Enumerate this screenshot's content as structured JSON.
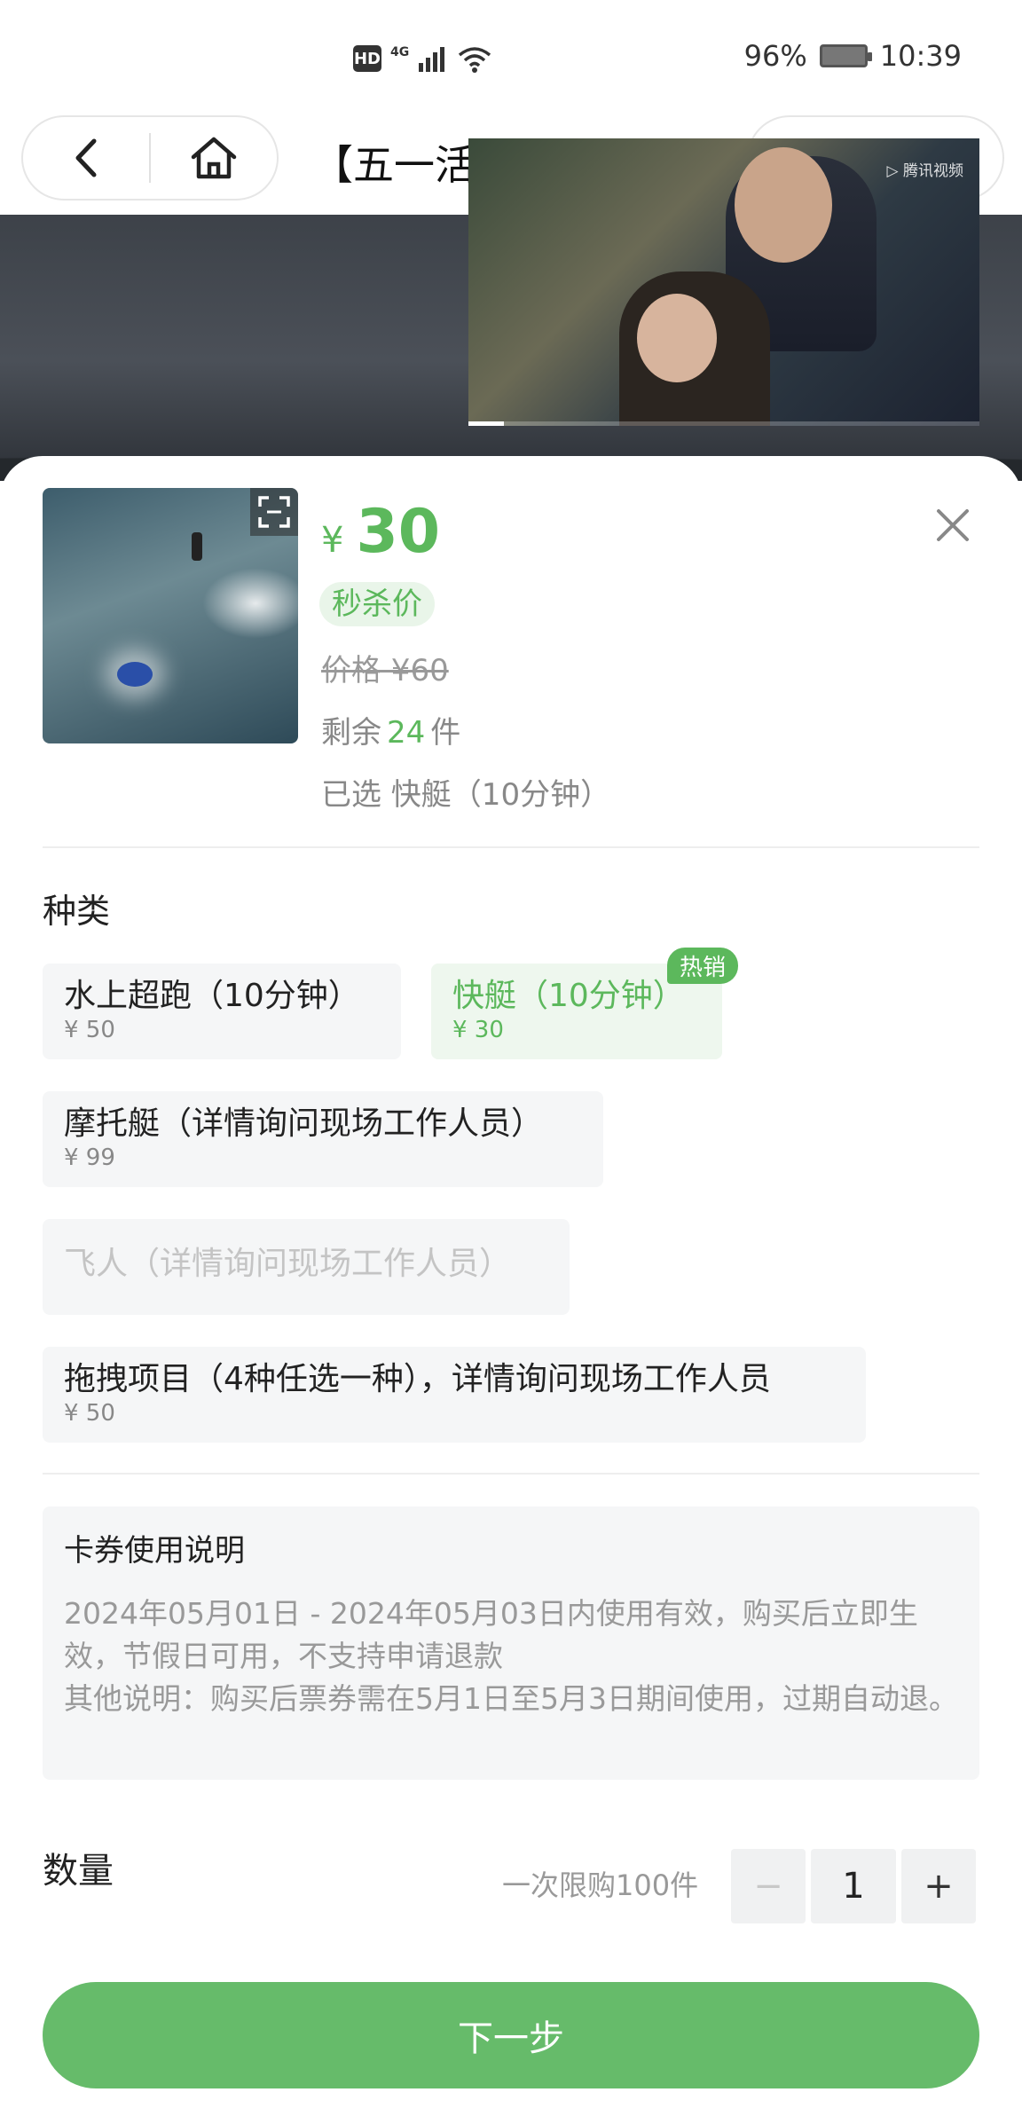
{
  "status_bar": {
    "hd": "HD",
    "network": "4G",
    "battery": "96%",
    "time": "10:39"
  },
  "nav": {
    "title": "【五一活",
    "back_icon": "chevron-left-icon",
    "home_icon": "home-icon"
  },
  "video": {
    "watermark": "腾讯视频",
    "progress": 0.07
  },
  "product": {
    "price_symbol": "¥",
    "price": "30",
    "tag": "秒杀价",
    "original_price": "价格 ¥60",
    "stock_prefix": "剩余",
    "stock_count": "24",
    "stock_suffix": "件",
    "selected_text": "已选 快艇（10分钟）"
  },
  "category": {
    "title": "种类",
    "options": [
      {
        "label": "水上超跑（10分钟）",
        "price": "¥ 50"
      },
      {
        "label": "快艇（10分钟）",
        "price": "¥ 30",
        "badge": "热销"
      },
      {
        "label": "摩托艇（详情询问现场工作人员）",
        "price": "¥ 99"
      },
      {
        "label": "飞人（详情询问现场工作人员）"
      },
      {
        "label": "拖拽项目（4种任选一种），详情询问现场工作人员",
        "price": "¥ 50"
      }
    ]
  },
  "notice": {
    "title": "卡券使用说明",
    "line1": "2024年05月01日 - 2024年05月03日内使用有效，购买后立即生效，节假日可用，不支持申请退款",
    "line2": "其他说明：购买后票券需在5月1日至5月3日期间使用，过期自动退。"
  },
  "quantity": {
    "label": "数量",
    "limit": "一次限购100件",
    "minus": "−",
    "value": "1",
    "plus": "+"
  },
  "next_button": "下一步",
  "colors": {
    "accent": "#5cb85c",
    "button": "#66bb6a"
  }
}
